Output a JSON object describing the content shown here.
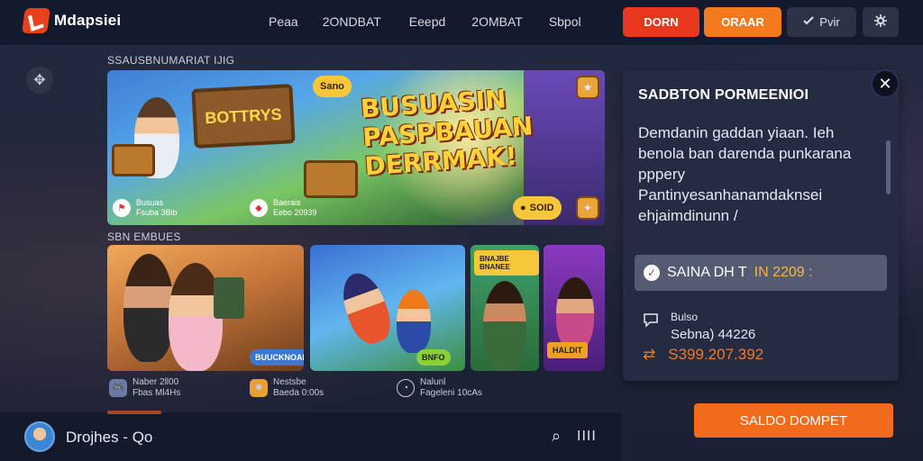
{
  "app": {
    "name": "Mdapsiei"
  },
  "nav": [
    {
      "label": "Peaa"
    },
    {
      "label": "2ONDBAT"
    },
    {
      "label": "Eeepd"
    },
    {
      "label": "2OMBAT"
    },
    {
      "label": "Sbpol"
    }
  ],
  "header_buttons": {
    "red": "DORN",
    "orange": "ORAAR",
    "dark": "Pvir",
    "dark_icon": "checkmark-icon",
    "last_icon": "settings-icon"
  },
  "sections": {
    "featured_title": "SSAUSBNUMARIAT IJIG",
    "games_title": "SBN EMBUES"
  },
  "banner": {
    "sign_text": "BOTTRYS",
    "pill_text": "Sano",
    "headline": "BUSUASIN PASPBAUAN DERRMAK!",
    "meta_left_1": "Busuas",
    "meta_left_2": "Fsuba 3Bib",
    "meta_mid_1": "Baerais",
    "meta_mid_2": "Eebo 20939",
    "cta_pill": "SOID"
  },
  "cards": [
    {
      "badge": "BUUCKNOAB",
      "meta_1": "Naber 2ll00",
      "meta_2": "Fbas Ml4Hs",
      "accent": "#f0a85a"
    },
    {
      "badge": "BNFO",
      "meta_1": "Nestsbe",
      "meta_2": "Baeda 0:00s",
      "accent": "#62b6ef"
    },
    {
      "badge": "BNAJBE BNANEE",
      "meta_1": "Nalunl",
      "meta_2": "Fageleni 10cAs",
      "accent": "#3fa06a"
    },
    {
      "badge": "HALDIT",
      "accent": "#8a3ac0"
    }
  ],
  "panel": {
    "title": "SADBTON PORMEENIOI",
    "body": "Demdanin gaddan yiaan. Ieh benola ban darenda punkarana pppery Pantinyesanhanamdaknsei ehjaimdinunn /",
    "status_prefix": "SAINA DH T",
    "status_highlight": "IN 2209 :",
    "row1_line1": "Bulso",
    "row1_line2": "Sebna) 44226",
    "price": "S399.207.392",
    "cta": "SALDO DOMPET"
  },
  "footer": {
    "user_name": "Drojhes -",
    "user_suffix": "Qo",
    "bars": "IIII"
  }
}
